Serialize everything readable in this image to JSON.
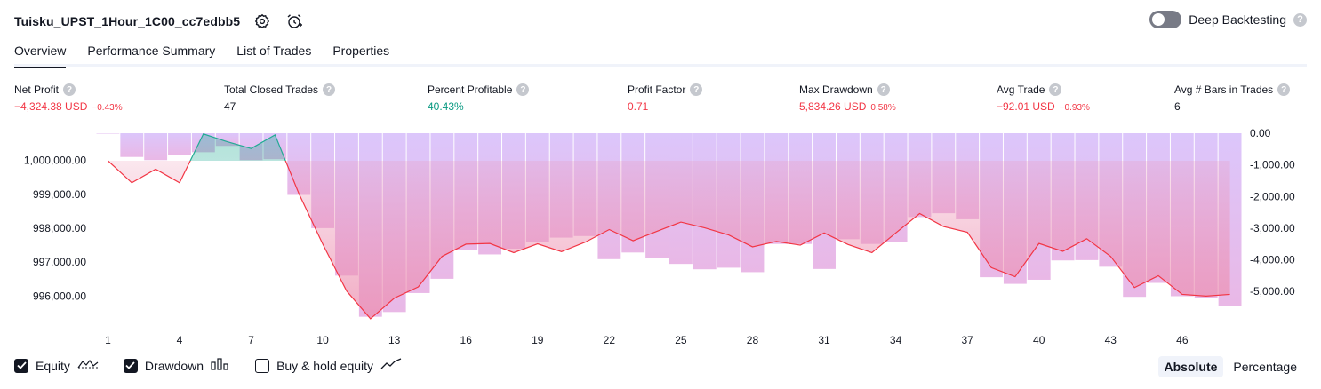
{
  "header": {
    "strategy_title": "Tuisku_UPST_1Hour_1C00_cc7edbb5",
    "deep_backtesting_label": "Deep Backtesting",
    "help_glyph": "?",
    "icons": [
      "settings-icon",
      "alarm-add-icon"
    ]
  },
  "tabs": [
    {
      "label": "Overview",
      "active": true
    },
    {
      "label": "Performance Summary",
      "active": false
    },
    {
      "label": "List of Trades",
      "active": false
    },
    {
      "label": "Properties",
      "active": false
    }
  ],
  "metrics": [
    {
      "label": "Net Profit",
      "value": "−4,324.38 USD",
      "pct": "−0.43%",
      "tone": "neg"
    },
    {
      "label": "Total Closed Trades",
      "value": "47",
      "pct": "",
      "tone": "plain"
    },
    {
      "label": "Percent Profitable",
      "value": "40.43%",
      "pct": "",
      "tone": "pos"
    },
    {
      "label": "Profit Factor",
      "value": "0.71",
      "pct": "",
      "tone": "neg"
    },
    {
      "label": "Max Drawdown",
      "value": "5,834.26 USD",
      "pct": "0.58%",
      "tone": "neg"
    },
    {
      "label": "Avg Trade",
      "value": "−92.01 USD",
      "pct": "−0.93%",
      "tone": "neg"
    },
    {
      "label": "Avg # Bars in Trades",
      "value": "6",
      "pct": "",
      "tone": "plain"
    }
  ],
  "chart_data": {
    "type": "line",
    "left_axis": {
      "ticks": [
        1000000,
        999000,
        998000,
        997000,
        996000
      ],
      "tick_labels": [
        "1,000,000.00",
        "999,000.00",
        "998,000.00",
        "997,000.00",
        "996,000.00"
      ],
      "range": [
        995250,
        1000800
      ]
    },
    "right_axis": {
      "ticks": [
        0,
        -1000,
        -2000,
        -3000,
        -4000,
        -5000
      ],
      "tick_labels": [
        "0.00",
        "-1,000.00",
        "-2,000.00",
        "-3,000.00",
        "-4,000.00",
        "-5,000.00"
      ],
      "range": [
        -5950,
        0
      ]
    },
    "x_tick_labels": [
      "1",
      "4",
      "7",
      "10",
      "13",
      "16",
      "19",
      "22",
      "25",
      "28",
      "31",
      "34",
      "37",
      "40",
      "43",
      "46"
    ],
    "x_ticks": [
      1,
      4,
      7,
      10,
      13,
      16,
      19,
      22,
      25,
      28,
      31,
      34,
      37,
      40,
      43,
      46
    ],
    "x_range": [
      1,
      48
    ],
    "series": [
      {
        "name": "Equity",
        "x": [
          1,
          2,
          3,
          4,
          5,
          6,
          7,
          8,
          9,
          10,
          11,
          12,
          13,
          14,
          15,
          16,
          17,
          18,
          19,
          20,
          21,
          22,
          23,
          24,
          25,
          26,
          27,
          28,
          29,
          30,
          31,
          32,
          33,
          34,
          35,
          36,
          37,
          38,
          39,
          40,
          41,
          42,
          43,
          44,
          45,
          46,
          47,
          48
        ],
        "values": [
          999990,
          999340,
          999740,
          999340,
          1000780,
          1000550,
          1000350,
          1000750,
          999020,
          997530,
          996150,
          995330,
          995940,
          996270,
          997170,
          997530,
          997550,
          997280,
          997540,
          997310,
          997590,
          997960,
          997630,
          997910,
          998180,
          998010,
          997800,
          997450,
          997610,
          997500,
          997860,
          997520,
          997280,
          997860,
          998430,
          998050,
          997880,
          996840,
          996570,
          997550,
          997320,
          997690,
          997170,
          996250,
          996600,
          996050,
          996000,
          996050
        ]
      },
      {
        "name": "Drawdown",
        "x": [
          1,
          2,
          3,
          4,
          5,
          6,
          7,
          8,
          9,
          10,
          11,
          12,
          13,
          14,
          15,
          16,
          17,
          18,
          19,
          20,
          21,
          22,
          23,
          24,
          25,
          26,
          27,
          28,
          29,
          30,
          31,
          32,
          33,
          34,
          35,
          36,
          37,
          38,
          39,
          40,
          41,
          42,
          43,
          44,
          45,
          46,
          47,
          48
        ],
        "values": [
          -10,
          -750,
          -850,
          -680,
          -600,
          -400,
          -850,
          -820,
          -1950,
          -3000,
          -4500,
          -5800,
          -5650,
          -5050,
          -4600,
          -3700,
          -3830,
          -3650,
          -3450,
          -3300,
          -3250,
          -3980,
          -3770,
          -3950,
          -4130,
          -4300,
          -4250,
          -4390,
          -3500,
          -3500,
          -4290,
          -3350,
          -3500,
          -3450,
          -2650,
          -2530,
          -2720,
          -4550,
          -4760,
          -4630,
          -4020,
          -4010,
          -4220,
          -5170,
          -4730,
          -5150,
          -5200,
          -5450
        ]
      }
    ],
    "colors": {
      "equity_up": "#22ab94",
      "equity_down": "#f23645",
      "drawdown_fill": "#d9c2fa"
    }
  },
  "legend": [
    {
      "label": "Equity",
      "checked": true,
      "icon": "equity-line-icon"
    },
    {
      "label": "Drawdown",
      "checked": true,
      "icon": "drawdown-bars-icon"
    },
    {
      "label": "Buy & hold equity",
      "checked": false,
      "icon": "buy-hold-line-icon"
    }
  ],
  "modes": [
    {
      "label": "Absolute",
      "active": true
    },
    {
      "label": "Percentage",
      "active": false
    }
  ]
}
